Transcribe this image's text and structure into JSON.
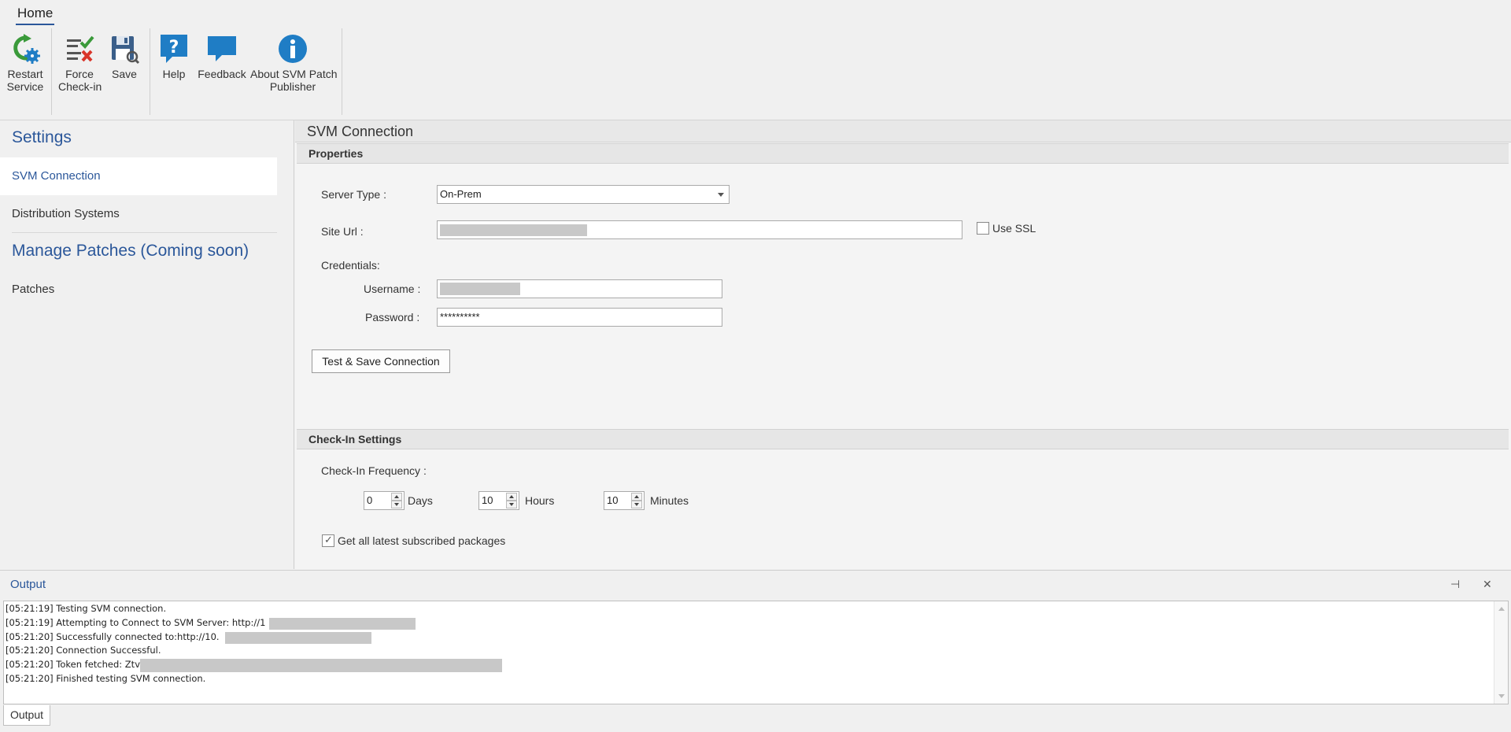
{
  "ribbon": {
    "tab": "Home",
    "buttons": {
      "restart": "Restart\nService",
      "force": "Force\nCheck-in",
      "save": "Save",
      "help": "Help",
      "feedback": "Feedback",
      "about": "About SVM Patch\nPublisher"
    },
    "icons": {
      "restart": "refresh-gear-icon",
      "force": "checklist-x-icon",
      "save": "floppy-disk-icon",
      "help": "question-bubble-icon",
      "feedback": "speech-bubble-icon",
      "about": "info-circle-icon"
    }
  },
  "sidebar": {
    "settings_heading": "Settings",
    "items": [
      "SVM Connection",
      "Distribution Systems"
    ],
    "manage_heading": "Manage Patches (Coming soon)",
    "manage_items": [
      "Patches"
    ]
  },
  "main": {
    "title": "SVM Connection",
    "properties": {
      "heading": "Properties",
      "server_type_label": "Server Type :",
      "server_type_value": "On-Prem",
      "site_url_label": "Site Url :",
      "use_ssl_label": "Use SSL",
      "credentials_label": "Credentials:",
      "username_label": "Username :",
      "password_label": "Password :",
      "password_value": "**********",
      "test_button": "Test & Save Connection"
    },
    "checkin": {
      "heading": "Check-In Settings",
      "frequency_label": "Check-In Frequency :",
      "days_value": "0",
      "days_label": "Days",
      "hours_value": "10",
      "hours_label": "Hours",
      "minutes_value": "10",
      "minutes_label": "Minutes",
      "get_all_label": "Get all latest subscribed packages",
      "get_all_checked": true
    }
  },
  "output": {
    "title": "Output",
    "pin_glyph": "⊣",
    "close_glyph": "✕",
    "tab": "Output",
    "log": [
      "[05:21:19] Testing SVM connection.",
      "[05:21:19] Attempting to Connect to SVM Server: http://1",
      "[05:21:20] Successfully connected to:http://10.",
      "[05:21:20] Connection Successful.",
      "[05:21:20] Token fetched: Ztv",
      "[05:21:20] Finished testing SVM connection."
    ]
  },
  "colors": {
    "accent": "#2b579a",
    "icon_blue": "#1f7dc5",
    "icon_green": "#3a9a3a",
    "icon_red": "#d9352a"
  }
}
